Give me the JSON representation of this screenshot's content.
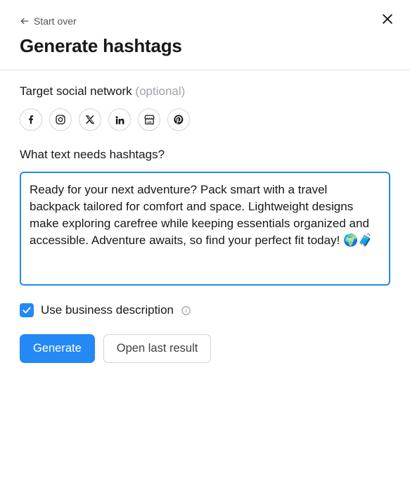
{
  "header": {
    "start_over_label": "Start over",
    "title": "Generate hashtags"
  },
  "target_network": {
    "label": "Target social network",
    "optional_suffix": "(optional)",
    "networks": [
      "facebook",
      "instagram",
      "x",
      "linkedin",
      "google-business",
      "pinterest"
    ]
  },
  "prompt": {
    "label": "What text needs hashtags?",
    "value": "Ready for your next adventure? Pack smart with a travel backpack tailored for comfort and space. Lightweight designs make exploring carefree while keeping essentials organized and accessible. Adventure awaits, so find your perfect fit today! 🌍🧳"
  },
  "business_desc": {
    "checked": true,
    "label": "Use business description"
  },
  "actions": {
    "generate_label": "Generate",
    "open_last_label": "Open last result"
  }
}
